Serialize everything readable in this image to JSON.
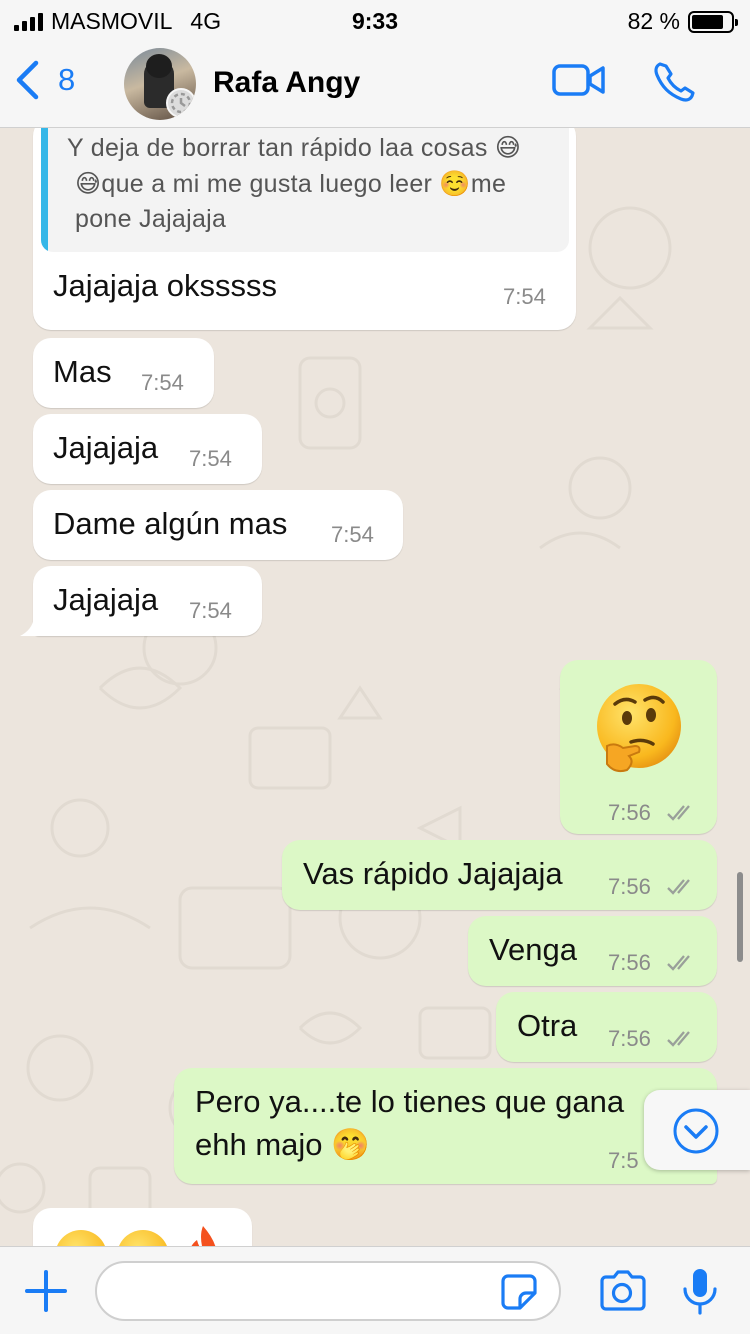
{
  "status_bar": {
    "carrier": "MASMOVIL",
    "network": "4G",
    "time": "9:33",
    "battery": "82 %",
    "battery_level": 0.82
  },
  "header": {
    "back_count": "8",
    "contact_name": "Rafa Angy",
    "accent_color": "#1a7cf5"
  },
  "messages": {
    "quote_lines": [
      "Y deja de borrar tan rápido laa cosas 😅",
      "😅que a mi me gusta luego leer ☺️me",
      "pone Jajajaja"
    ],
    "m1_text": "Jajajaja oksssss",
    "m1_time": "7:54",
    "m2_text": "Mas",
    "m2_time": "7:54",
    "m3_text": "Jajajaja",
    "m3_time": "7:54",
    "m4_text": "Dame algún mas",
    "m4_time": "7:54",
    "m5_text": "Jajajaja",
    "m5_time": "7:54",
    "m6_emoji": "🤔",
    "m6_time": "7:56",
    "m7_text": "Vas rápido Jajajaja",
    "m7_time": "7:56",
    "m8_text": "Venga",
    "m8_time": "7:56",
    "m9_text": "Otra",
    "m9_time": "7:56",
    "m10_line1": "Pero ya....te lo tienes que gana",
    "m10_line2": "ehh majo 🤭",
    "m10_time": "7:5",
    "incoming_color": "#ffffff",
    "outgoing_color": "#dcf8c6"
  },
  "input": {
    "placeholder": "",
    "icons": [
      "plus-icon",
      "sticker-icon",
      "camera-icon",
      "microphone-icon"
    ]
  }
}
